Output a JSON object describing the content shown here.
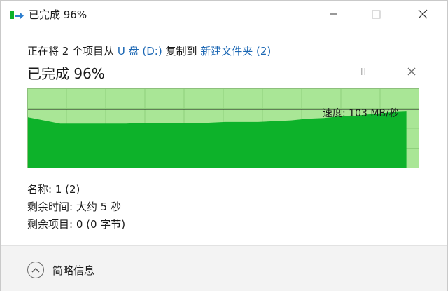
{
  "window": {
    "title": "已完成 96%"
  },
  "header": {
    "prefix": "正在将 2 个项目从 ",
    "source": "U 盘 (D:)",
    "middle": " 复制到 ",
    "destination": "新建文件夹 (2)",
    "progress_label": "已完成 96%"
  },
  "progress": {
    "percent": 96
  },
  "chart_data": {
    "type": "area",
    "title": "",
    "xlabel": "",
    "ylabel": "",
    "progress_fraction_shown": 0.96,
    "speed_label": "速度: 103 MB/秒",
    "current_speed_mb_per_s": 103,
    "relative_speed_trend": [
      0.64,
      0.6,
      0.56,
      0.56,
      0.56,
      0.56,
      0.56,
      0.57,
      0.57,
      0.57,
      0.57,
      0.57,
      0.58,
      0.58,
      0.58,
      0.59,
      0.6,
      0.62,
      0.63,
      0.65,
      0.66,
      0.68,
      0.7,
      0.71
    ],
    "grid": true
  },
  "details": {
    "name": "名称: 1 (2)",
    "time_remaining": "剩余时间: 大约 5 秒",
    "items_remaining": "剩余项目: 0 (0 字节)"
  },
  "footer": {
    "collapse_label": "简略信息"
  },
  "colors": {
    "chart_bg": "#a9e696",
    "chart_fill": "#0db22a",
    "chart_grid": "#8fd07c",
    "chart_border": "#8dbf7c",
    "link": "#1a66b3"
  }
}
